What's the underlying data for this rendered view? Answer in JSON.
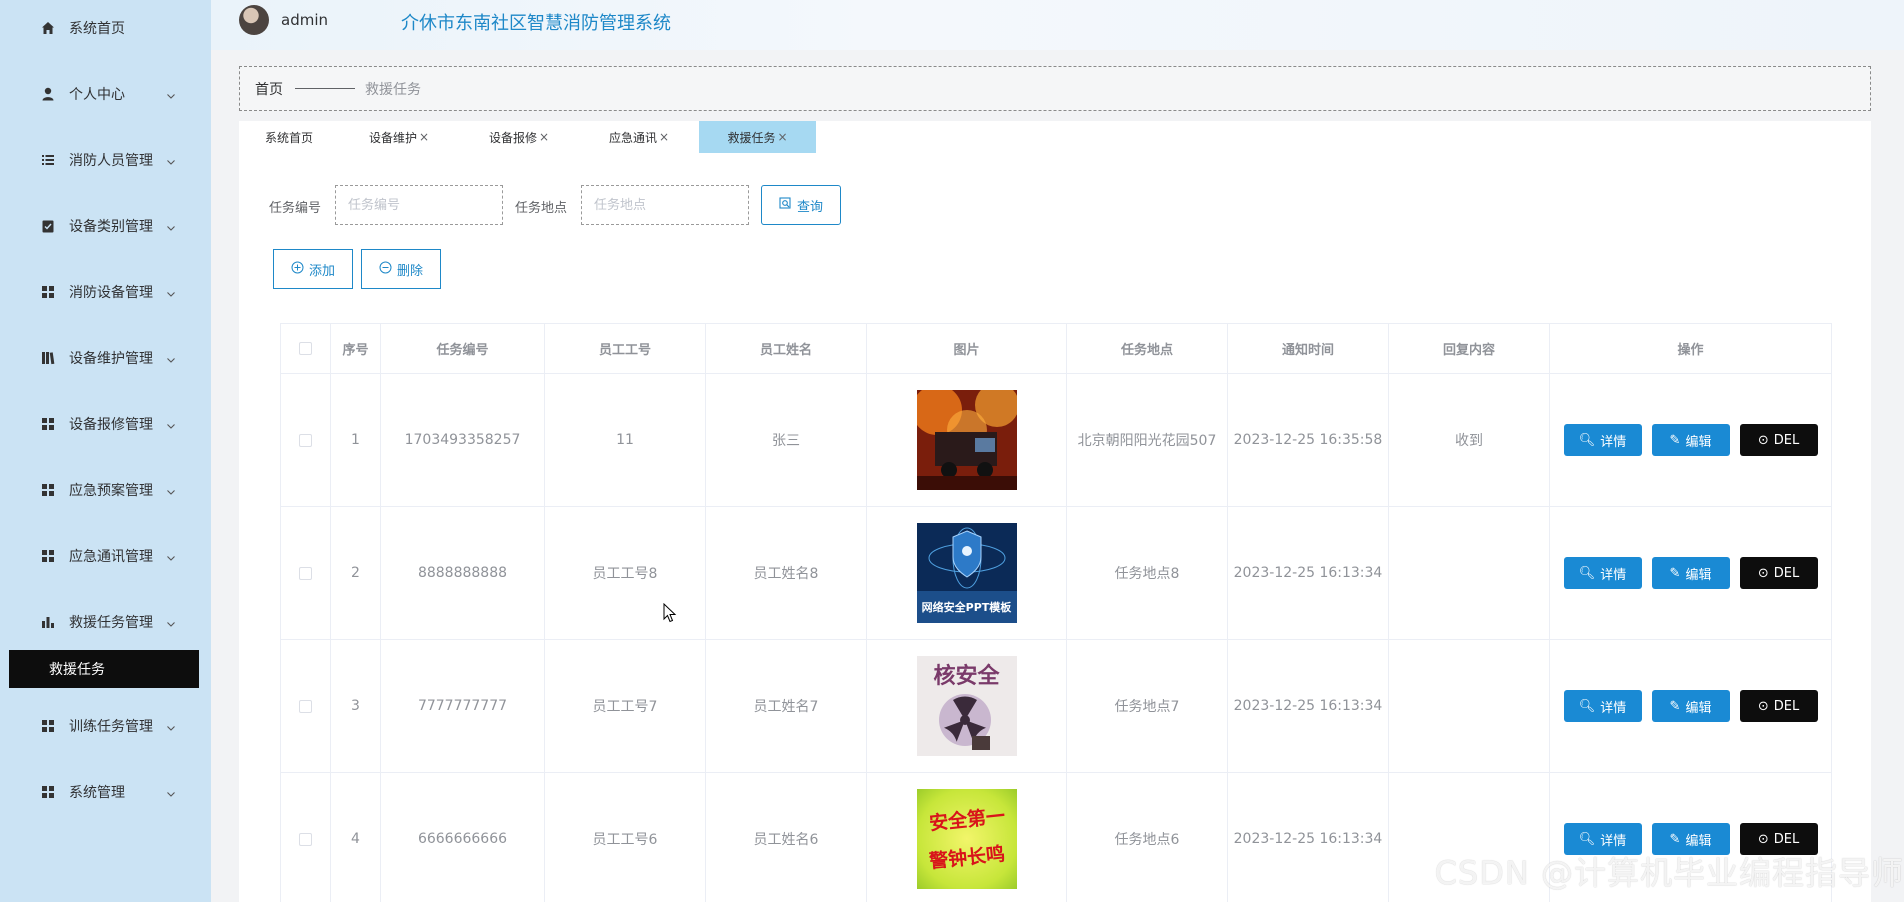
{
  "sidebar": {
    "items": [
      {
        "label": "系统首页",
        "icon": "home-icon",
        "has_arrow": false
      },
      {
        "label": "个人中心",
        "icon": "user-icon",
        "has_arrow": true
      },
      {
        "label": "消防人员管理",
        "icon": "list-icon",
        "has_arrow": true
      },
      {
        "label": "设备类别管理",
        "icon": "clipboard-check-icon",
        "has_arrow": true
      },
      {
        "label": "消防设备管理",
        "icon": "grid-icon",
        "has_arrow": true
      },
      {
        "label": "设备维护管理",
        "icon": "books-icon",
        "has_arrow": true
      },
      {
        "label": "设备报修管理",
        "icon": "grid-icon",
        "has_arrow": true
      },
      {
        "label": "应急预案管理",
        "icon": "grid-icon",
        "has_arrow": true
      },
      {
        "label": "应急通讯管理",
        "icon": "grid-icon",
        "has_arrow": true
      },
      {
        "label": "救援任务管理",
        "icon": "bar-chart-icon",
        "has_arrow": true
      },
      {
        "label": "训练任务管理",
        "icon": "grid-icon",
        "has_arrow": true
      },
      {
        "label": "系统管理",
        "icon": "grid-icon",
        "has_arrow": true
      }
    ],
    "active_submenu": "救援任务"
  },
  "header": {
    "username": "admin",
    "title": "介休市东南社区智慧消防管理系统"
  },
  "breadcrumb": {
    "home": "首页",
    "current": "救援任务"
  },
  "tabs": [
    {
      "label": "系统首页",
      "closable": false,
      "active": false
    },
    {
      "label": "设备维护",
      "closable": true,
      "active": false
    },
    {
      "label": "设备报修",
      "closable": true,
      "active": false
    },
    {
      "label": "应急通讯",
      "closable": true,
      "active": false
    },
    {
      "label": "救援任务",
      "closable": true,
      "active": true
    }
  ],
  "search": {
    "task_no_label": "任务编号",
    "task_no_placeholder": "任务编号",
    "task_no_value": "",
    "location_label": "任务地点",
    "location_placeholder": "任务地点",
    "location_value": "",
    "query_label": "查询"
  },
  "actions": {
    "add_label": "添加",
    "delete_label": "删除"
  },
  "table": {
    "columns": [
      "序号",
      "任务编号",
      "员工工号",
      "员工姓名",
      "图片",
      "任务地点",
      "通知时间",
      "回复内容",
      "操作"
    ],
    "rows": [
      {
        "index": "1",
        "task_no": "1703493358257",
        "emp_no": "11",
        "emp_name": "张三",
        "image": "fire-truck-image",
        "location": "北京朝阳阳光花园507",
        "time": "2023-12-25 16:35:58",
        "reply": "收到"
      },
      {
        "index": "2",
        "task_no": "8888888888",
        "emp_no": "员工工号8",
        "emp_name": "员工姓名8",
        "image": "network-security-image",
        "location": "任务地点8",
        "time": "2023-12-25 16:13:34",
        "reply": ""
      },
      {
        "index": "3",
        "task_no": "7777777777",
        "emp_no": "员工工号7",
        "emp_name": "员工姓名7",
        "image": "nuclear-safety-image",
        "location": "任务地点7",
        "time": "2023-12-25 16:13:34",
        "reply": ""
      },
      {
        "index": "4",
        "task_no": "6666666666",
        "emp_no": "员工工号6",
        "emp_name": "员工姓名6",
        "image": "safety-first-image",
        "location": "任务地点6",
        "time": "2023-12-25 16:13:34",
        "reply": ""
      }
    ],
    "row_actions": {
      "detail": "详情",
      "edit": "编辑",
      "del": "DEL"
    }
  },
  "images": {
    "img2_text": "网络安全PPT模板",
    "img3_text": "核安全",
    "img4_line1": "安全第一",
    "img4_line2": "警钟长鸣"
  },
  "watermark": "CSDN @计算机毕业编程指导师",
  "colors": {
    "sidebar_bg": "#cbe3f4",
    "accent": "#1e88c8",
    "active_submenu_bg": "#0d0d0d",
    "active_tab_bg": "#a6d9f2",
    "button_blue": "#1a8ad4",
    "button_black": "#0d0d0d"
  }
}
